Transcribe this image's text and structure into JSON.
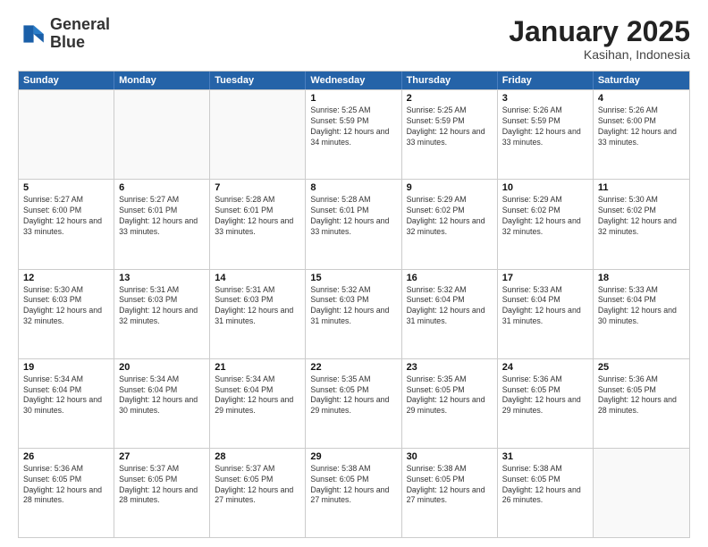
{
  "logo": {
    "line1": "General",
    "line2": "Blue"
  },
  "title": "January 2025",
  "subtitle": "Kasihan, Indonesia",
  "header_days": [
    "Sunday",
    "Monday",
    "Tuesday",
    "Wednesday",
    "Thursday",
    "Friday",
    "Saturday"
  ],
  "weeks": [
    [
      {
        "day": "",
        "info": "",
        "empty": true
      },
      {
        "day": "",
        "info": "",
        "empty": true
      },
      {
        "day": "",
        "info": "",
        "empty": true
      },
      {
        "day": "1",
        "info": "Sunrise: 5:25 AM\nSunset: 5:59 PM\nDaylight: 12 hours\nand 34 minutes."
      },
      {
        "day": "2",
        "info": "Sunrise: 5:25 AM\nSunset: 5:59 PM\nDaylight: 12 hours\nand 33 minutes."
      },
      {
        "day": "3",
        "info": "Sunrise: 5:26 AM\nSunset: 5:59 PM\nDaylight: 12 hours\nand 33 minutes."
      },
      {
        "day": "4",
        "info": "Sunrise: 5:26 AM\nSunset: 6:00 PM\nDaylight: 12 hours\nand 33 minutes."
      }
    ],
    [
      {
        "day": "5",
        "info": "Sunrise: 5:27 AM\nSunset: 6:00 PM\nDaylight: 12 hours\nand 33 minutes."
      },
      {
        "day": "6",
        "info": "Sunrise: 5:27 AM\nSunset: 6:01 PM\nDaylight: 12 hours\nand 33 minutes."
      },
      {
        "day": "7",
        "info": "Sunrise: 5:28 AM\nSunset: 6:01 PM\nDaylight: 12 hours\nand 33 minutes."
      },
      {
        "day": "8",
        "info": "Sunrise: 5:28 AM\nSunset: 6:01 PM\nDaylight: 12 hours\nand 33 minutes."
      },
      {
        "day": "9",
        "info": "Sunrise: 5:29 AM\nSunset: 6:02 PM\nDaylight: 12 hours\nand 32 minutes."
      },
      {
        "day": "10",
        "info": "Sunrise: 5:29 AM\nSunset: 6:02 PM\nDaylight: 12 hours\nand 32 minutes."
      },
      {
        "day": "11",
        "info": "Sunrise: 5:30 AM\nSunset: 6:02 PM\nDaylight: 12 hours\nand 32 minutes."
      }
    ],
    [
      {
        "day": "12",
        "info": "Sunrise: 5:30 AM\nSunset: 6:03 PM\nDaylight: 12 hours\nand 32 minutes."
      },
      {
        "day": "13",
        "info": "Sunrise: 5:31 AM\nSunset: 6:03 PM\nDaylight: 12 hours\nand 32 minutes."
      },
      {
        "day": "14",
        "info": "Sunrise: 5:31 AM\nSunset: 6:03 PM\nDaylight: 12 hours\nand 31 minutes."
      },
      {
        "day": "15",
        "info": "Sunrise: 5:32 AM\nSunset: 6:03 PM\nDaylight: 12 hours\nand 31 minutes."
      },
      {
        "day": "16",
        "info": "Sunrise: 5:32 AM\nSunset: 6:04 PM\nDaylight: 12 hours\nand 31 minutes."
      },
      {
        "day": "17",
        "info": "Sunrise: 5:33 AM\nSunset: 6:04 PM\nDaylight: 12 hours\nand 31 minutes."
      },
      {
        "day": "18",
        "info": "Sunrise: 5:33 AM\nSunset: 6:04 PM\nDaylight: 12 hours\nand 30 minutes."
      }
    ],
    [
      {
        "day": "19",
        "info": "Sunrise: 5:34 AM\nSunset: 6:04 PM\nDaylight: 12 hours\nand 30 minutes."
      },
      {
        "day": "20",
        "info": "Sunrise: 5:34 AM\nSunset: 6:04 PM\nDaylight: 12 hours\nand 30 minutes."
      },
      {
        "day": "21",
        "info": "Sunrise: 5:34 AM\nSunset: 6:04 PM\nDaylight: 12 hours\nand 29 minutes."
      },
      {
        "day": "22",
        "info": "Sunrise: 5:35 AM\nSunset: 6:05 PM\nDaylight: 12 hours\nand 29 minutes."
      },
      {
        "day": "23",
        "info": "Sunrise: 5:35 AM\nSunset: 6:05 PM\nDaylight: 12 hours\nand 29 minutes."
      },
      {
        "day": "24",
        "info": "Sunrise: 5:36 AM\nSunset: 6:05 PM\nDaylight: 12 hours\nand 29 minutes."
      },
      {
        "day": "25",
        "info": "Sunrise: 5:36 AM\nSunset: 6:05 PM\nDaylight: 12 hours\nand 28 minutes."
      }
    ],
    [
      {
        "day": "26",
        "info": "Sunrise: 5:36 AM\nSunset: 6:05 PM\nDaylight: 12 hours\nand 28 minutes."
      },
      {
        "day": "27",
        "info": "Sunrise: 5:37 AM\nSunset: 6:05 PM\nDaylight: 12 hours\nand 28 minutes."
      },
      {
        "day": "28",
        "info": "Sunrise: 5:37 AM\nSunset: 6:05 PM\nDaylight: 12 hours\nand 27 minutes."
      },
      {
        "day": "29",
        "info": "Sunrise: 5:38 AM\nSunset: 6:05 PM\nDaylight: 12 hours\nand 27 minutes."
      },
      {
        "day": "30",
        "info": "Sunrise: 5:38 AM\nSunset: 6:05 PM\nDaylight: 12 hours\nand 27 minutes."
      },
      {
        "day": "31",
        "info": "Sunrise: 5:38 AM\nSunset: 6:05 PM\nDaylight: 12 hours\nand 26 minutes."
      },
      {
        "day": "",
        "info": "",
        "empty": true
      }
    ]
  ]
}
